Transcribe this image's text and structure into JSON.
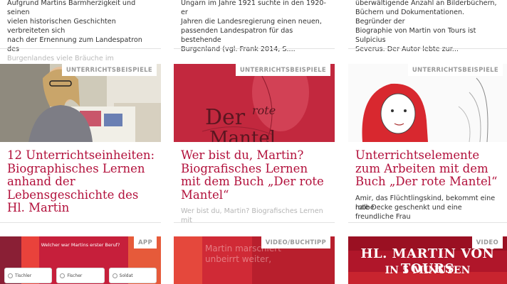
{
  "top_row": [
    {
      "lines": [
        "Aufgrund Martins Barmherzigkeit und seinen",
        "vielen historischen Geschichten verbreiteten sich",
        "nach der Ernennung zum Landespatron des",
        "Burgenlandes viele Bräuche im Burgenland. Die"
      ]
    },
    {
      "lines": [
        "Ungarn im Jahre 1921 suchte in den 1920-er",
        "Jahren die Landesregierung einen neuen,",
        "passenden Landespatron für das bestehende",
        "Burgenland (vgl. Frank 2014, S...."
      ]
    },
    {
      "lines": [
        "überwältigende Anzahl an Bilderbüchern,",
        "Büchern und Dokumentationen. Begründer der",
        "Biographie von Martin von Tours ist Sulpicius",
        "Severus. Der Autor lebte zur..."
      ]
    }
  ],
  "cards": [
    {
      "tag": "UNTERRICHTSBEISPIELE",
      "title_lines": [
        "12 Unterrichtseinheiten:",
        "Biographisches Lernen",
        "anhand der",
        "Lebensgeschichte des",
        "Hl. Martin"
      ],
      "sub_lines": []
    },
    {
      "tag": "UNTERRICHTSBEISPIELE",
      "title_lines": [
        "Wer bist du, Martin?",
        "Biografisches Lernen",
        "mit dem Buch „Der rote",
        "Mantel“"
      ],
      "sub_lines": [
        "Wer bist du, Martin? Biografisches Lernen mit"
      ],
      "book_word1": "Der",
      "book_word2": "rote",
      "book_word3": "Mantel"
    },
    {
      "tag": "UNTERRICHTSBEISPIELE",
      "title_lines": [
        "Unterrichtselemente",
        "zum Arbeiten mit dem",
        "Buch „Der rote Mantel“"
      ],
      "sub_lines": [
        "Amir, das Flüchtlingskind, bekommt eine halbe",
        "rote Decke geschenkt und eine freundliche Frau"
      ]
    }
  ],
  "bottom": [
    {
      "tag": "APP",
      "question": "Welcher war Martins erster Beruf?",
      "options": [
        "Tischler",
        "Fischer",
        "Soldat"
      ]
    },
    {
      "tag": "VIDEO/BUCHTIPP",
      "overlay_lines": [
        "Martin marschiert",
        "unbeirrt weiter,"
      ]
    },
    {
      "tag": "VIDEO",
      "line1": "HL. MARTIN VON TOURS",
      "line2": "IN 5 MINUTEN"
    }
  ],
  "colors": {
    "title": "#b2103b",
    "tag_text": "#9a9a9a"
  }
}
